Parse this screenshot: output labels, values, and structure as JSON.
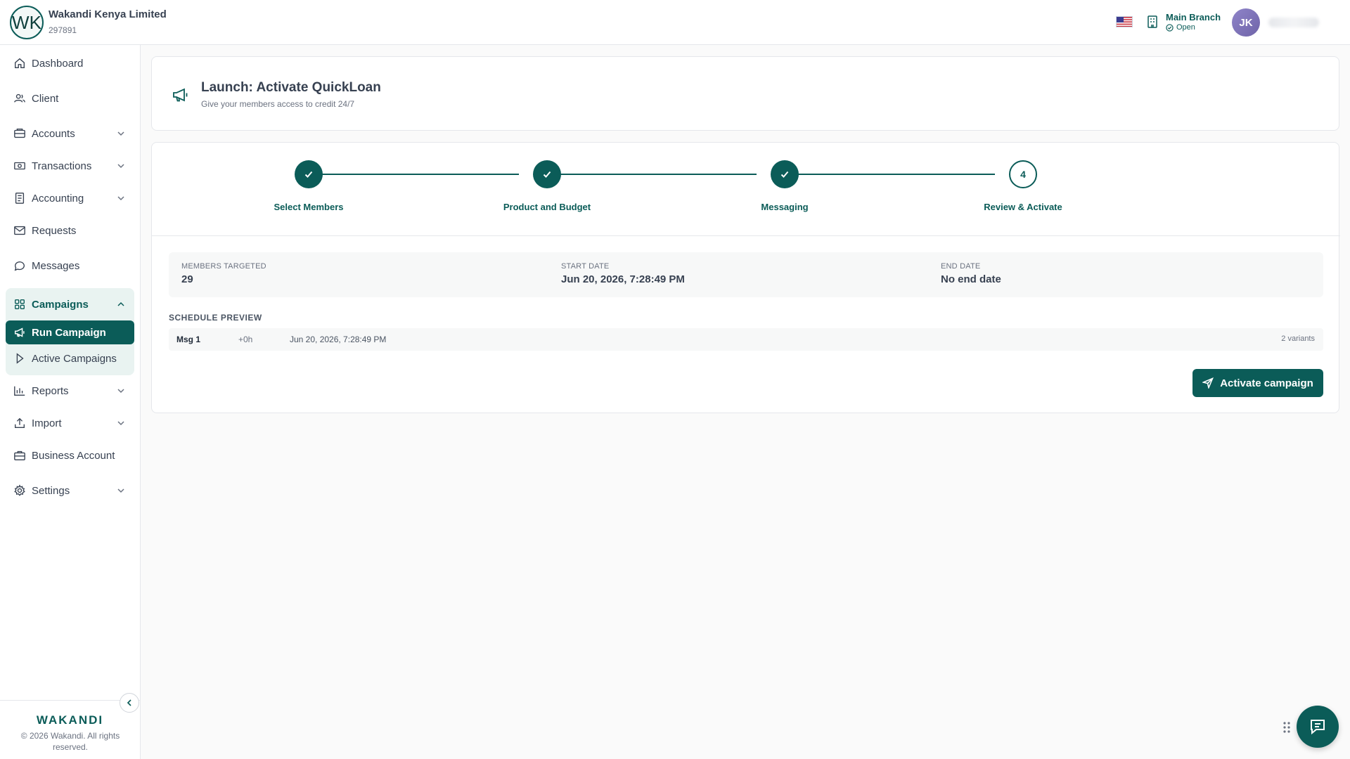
{
  "org": {
    "initials": "WK",
    "name": "Wakandi Kenya Limited",
    "id": "297891"
  },
  "header": {
    "branch_name": "Main Branch",
    "branch_status": "Open",
    "user_initials": "JK",
    "locale_icon": "us-flag-icon"
  },
  "sidebar": {
    "items": [
      {
        "label": "Dashboard",
        "icon": "home-icon"
      },
      {
        "label": "Client",
        "icon": "users-icon"
      },
      {
        "label": "Accounts",
        "icon": "wallet-icon",
        "expandable": true
      },
      {
        "label": "Transactions",
        "icon": "banknote-icon",
        "expandable": true
      },
      {
        "label": "Accounting",
        "icon": "ledger-icon",
        "expandable": true
      },
      {
        "label": "Requests",
        "icon": "mail-icon"
      },
      {
        "label": "Messages",
        "icon": "chat-icon"
      },
      {
        "label": "Campaigns",
        "icon": "grid-icon",
        "expandable": true,
        "expanded": true
      },
      {
        "label": "Run Campaign",
        "icon": "megaphone-icon",
        "active": true
      },
      {
        "label": "Active Campaigns",
        "icon": "play-icon"
      },
      {
        "label": "Reports",
        "icon": "bar-chart-icon",
        "expandable": true
      },
      {
        "label": "Import",
        "icon": "upload-icon",
        "expandable": true
      },
      {
        "label": "Business Account",
        "icon": "briefcase-icon"
      },
      {
        "label": "Settings",
        "icon": "gear-icon",
        "expandable": true
      }
    ],
    "brand": "WAKANDI",
    "copyright": "© 2026 Wakandi. All rights reserved."
  },
  "launch": {
    "title": "Launch: Activate QuickLoan",
    "subtitle": "Give your members access to credit 24/7"
  },
  "steps": [
    {
      "label": "Select Members",
      "state": "complete"
    },
    {
      "label": "Product and Budget",
      "state": "complete"
    },
    {
      "label": "Messaging",
      "state": "complete"
    },
    {
      "label": "Review & Activate",
      "state": "current",
      "number": "4"
    }
  ],
  "summary": {
    "members_label": "MEMBERS TARGETED",
    "members_value": "29",
    "start_label": "START DATE",
    "start_value": "Jun 20, 2026, 7:28:49 PM",
    "end_label": "END DATE",
    "end_value": "No end date"
  },
  "schedule": {
    "title": "SCHEDULE PREVIEW",
    "rows": [
      {
        "msg": "Msg 1",
        "offset": "+0h",
        "time": "Jun 20, 2026, 7:28:49 PM",
        "variants": "2 variants"
      }
    ]
  },
  "actions": {
    "activate_label": "Activate campaign"
  },
  "colors": {
    "primary": "#0b5c58",
    "primary_light": "#e9f3f1"
  }
}
